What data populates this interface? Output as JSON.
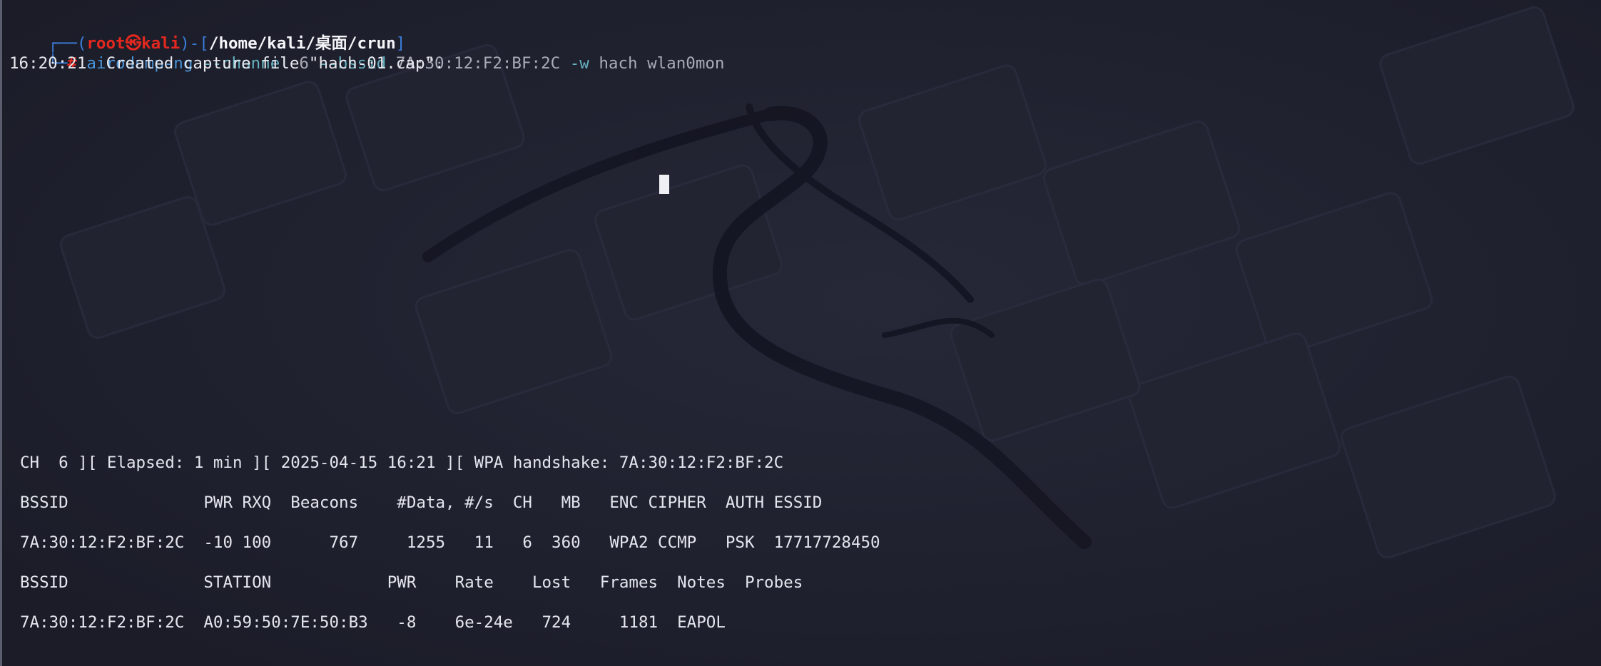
{
  "terminal": {
    "prompt": {
      "tl_corner": "┌──(",
      "user": "root",
      "at_glyph": "㉿",
      "host": "kali",
      "mid": ")-[",
      "path": "/home/kali/桌面/crun",
      "end": "]",
      "bl_corner": "└─",
      "hash": "#"
    },
    "command": {
      "program": "airodump-ng",
      "opt_channel": "--channel",
      "channel_val": "6",
      "opt_bssid": "--bssid",
      "bssid_val": "7A:30:12:F2:BF:2C",
      "opt_write": "-w",
      "write_val": "hach",
      "iface": "wlan0mon"
    },
    "output_line": "16:20:21  Created capture file \"hach-01.cap\"."
  },
  "airodump": {
    "status_line": "CH  6 ][ Elapsed: 1 min ][ 2025-04-15 16:21 ][ WPA handshake: 7A:30:12:F2:BF:2C",
    "ap_header": "BSSID              PWR RXQ  Beacons    #Data, #/s  CH   MB   ENC CIPHER  AUTH ESSID",
    "ap_row": "7A:30:12:F2:BF:2C  -10 100      767     1255   11   6  360   WPA2 CCMP   PSK  17717728450",
    "station_header": "BSSID              STATION            PWR    Rate    Lost   Frames  Notes  Probes",
    "station_row": "7A:30:12:F2:BF:2C  A0:59:50:7E:50:B3   -8    6e-24e   724     1181  EAPOL"
  },
  "colors": {
    "background": "#1e1f2c",
    "prompt_frame": "#3b7dd8",
    "prompt_user_host": "#e2281f",
    "command": "#4a93d6",
    "option": "#66b2c0"
  },
  "icons": {
    "wallpaper": "kali-dragon-wallpaper",
    "cursor": "block-cursor"
  }
}
